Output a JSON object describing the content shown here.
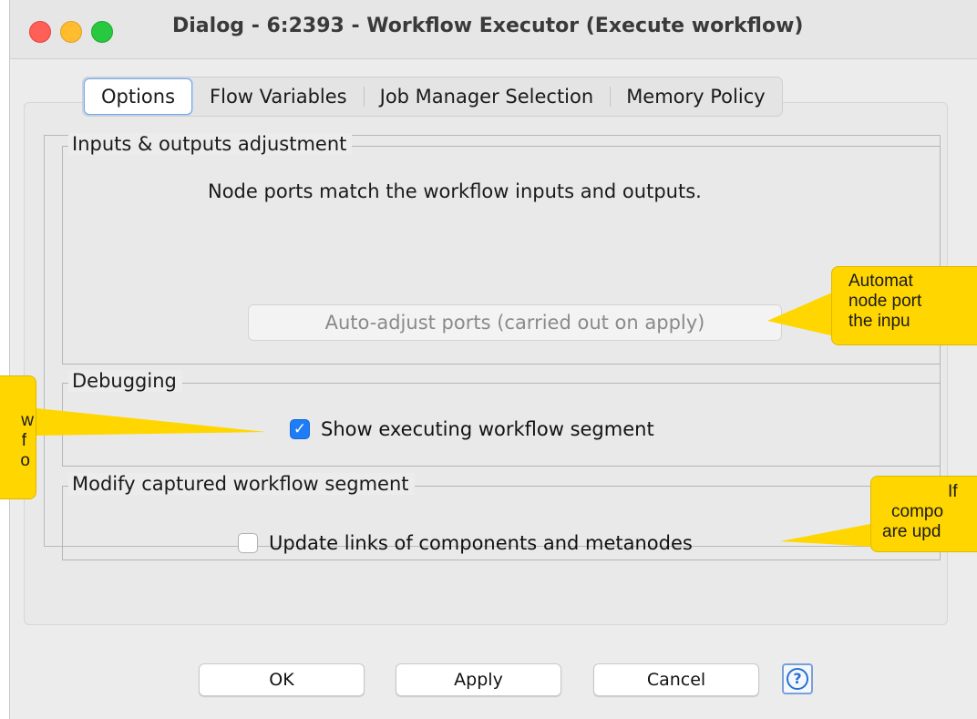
{
  "window": {
    "title": "Dialog - 6:2393 - Workflow Executor (Execute workflow)"
  },
  "tabs": [
    {
      "label": "Options",
      "active": true
    },
    {
      "label": "Flow Variables",
      "active": false
    },
    {
      "label": "Job Manager Selection",
      "active": false
    },
    {
      "label": "Memory Policy",
      "active": false
    }
  ],
  "inputs_outputs": {
    "legend": "Inputs & outputs adjustment",
    "status_text": "Node ports match the workflow inputs and outputs.",
    "auto_adjust_label": "Auto-adjust ports (carried out on apply)"
  },
  "debugging": {
    "legend": "Debugging",
    "show_segment_label": "Show executing workflow segment",
    "show_segment_checked": true
  },
  "modify_segment": {
    "legend": "Modify captured workflow segment",
    "update_links_label": "Update links of components and metanodes",
    "update_links_checked": false
  },
  "buttons": {
    "ok": "OK",
    "apply": "Apply",
    "cancel": "Cancel",
    "help_icon": "question-mark-icon"
  },
  "callouts": {
    "auto_adjust": [
      "Automat",
      "node port",
      "the inpu"
    ],
    "debugging": [
      "w",
      "f",
      "o"
    ],
    "update_links": [
      "If",
      "compo",
      "are upd"
    ]
  },
  "colors": {
    "callout": "#ffd600",
    "checkbox_checked": "#1e7cf6",
    "tab_active_border": "#7aa7e0"
  }
}
